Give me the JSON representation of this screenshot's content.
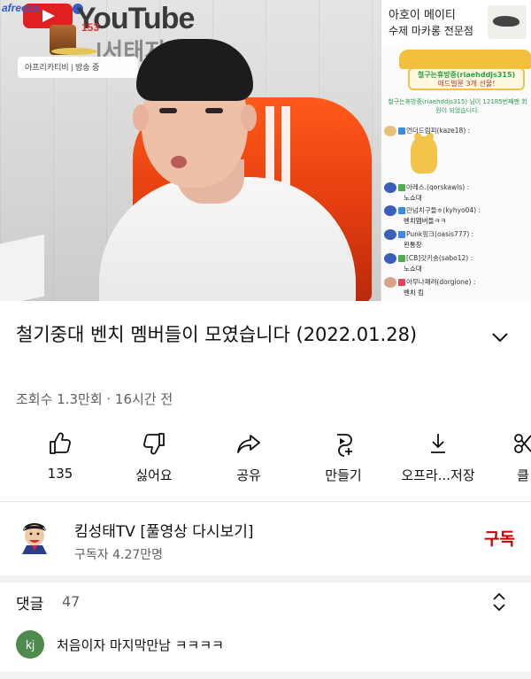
{
  "video": {
    "overlay": {
      "brand": "afreeca",
      "sign_main": "YouTube",
      "sign_sub": "|서태지",
      "rank_number": "153",
      "label": "아프리카티비 | 방송 중"
    },
    "chat": {
      "header_line1": "아호이 메이티",
      "header_line2": "수제 마카롱 전문점",
      "gift_line1": "철구는휴방중(riaehddjs315)",
      "gift_line2": "애드벌룬 3개 선물!",
      "notice": "철구는휴방중(riaehddjs315) 님이 12185번째팬 회원이 되었습니다.",
      "messages": [
        {
          "user": "언더드림피(kaze18) :",
          "text": ""
        },
        {
          "user": "아레스.(qorskawls) :",
          "text": "노쇼대"
        },
        {
          "user": "만넘치구들ㅎ(kyhyo04) :",
          "text": "벤치멤버들ㅋㅋ"
        },
        {
          "user": "Punk핑크(oasis777) :",
          "text": "왼통창"
        },
        {
          "user": "[CB]갓키송(sabo12) :",
          "text": "노쇼대"
        },
        {
          "user": "아무나패려(dorgione) :",
          "text": "벤치 킴"
        }
      ]
    }
  },
  "title": "철기중대 벤치 멤버들이 모였습니다 (2022.01.28)",
  "meta": "조회수 1.3만회 · 16시간 전",
  "actions": [
    {
      "icon": "thumbs-up-icon",
      "label": "135"
    },
    {
      "icon": "thumbs-down-icon",
      "label": "싫어요"
    },
    {
      "icon": "share-icon",
      "label": "공유"
    },
    {
      "icon": "create-icon",
      "label": "만들기"
    },
    {
      "icon": "download-icon",
      "label": "오프라...저장"
    },
    {
      "icon": "clip-icon",
      "label": "클"
    }
  ],
  "channel": {
    "name": "킴성태TV [풀영상 다시보기]",
    "subscribers": "구독자 4.27만명",
    "subscribe_label": "구독"
  },
  "comments": {
    "header": "댓글",
    "count": "47",
    "first": {
      "avatar_initials": "kj",
      "text": "처음이자 마지막만남 ㅋㅋㅋㅋ"
    }
  },
  "colors": {
    "subscribe": "#cc0000",
    "youtube_red": "#e02020",
    "meta_text": "#606060",
    "comment_avatar": "#4f8a4e"
  }
}
